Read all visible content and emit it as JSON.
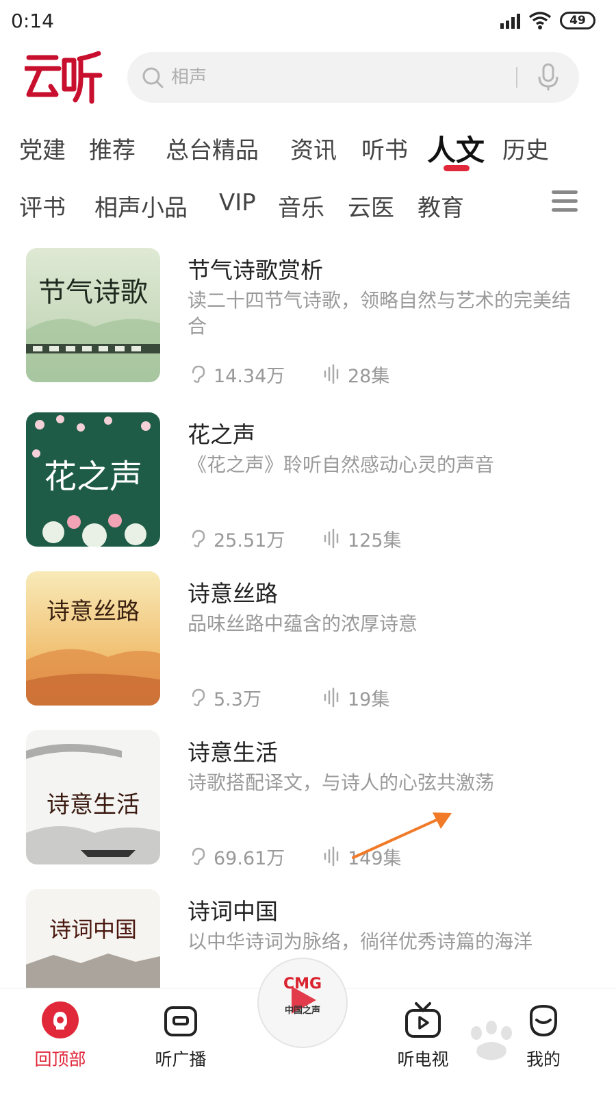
{
  "status_bar": {
    "time": "0:14",
    "battery": "49"
  },
  "app": {
    "logo_text": "云听"
  },
  "search": {
    "placeholder": "相声"
  },
  "tabs_row1": [
    "党建",
    "推荐",
    "总台精品",
    "资讯",
    "听书",
    "人文",
    "历史"
  ],
  "tabs_row2": [
    "评书",
    "相声小品",
    "VIP",
    "音乐",
    "云医",
    "教育"
  ],
  "active_tab": "人文",
  "programs": [
    {
      "title": "节气诗歌赏析",
      "description": "读二十四节气诗歌，领略自然与艺术的完美结合",
      "plays": "14.34万",
      "episodes": "28集",
      "cover_text": "节气诗歌"
    },
    {
      "title": "花之声",
      "description": "《花之声》聆听自然感动心灵的声音",
      "plays": "25.51万",
      "episodes": "125集",
      "cover_text": "花之声"
    },
    {
      "title": "诗意丝路",
      "description": "品味丝路中蕴含的浓厚诗意",
      "plays": "5.3万",
      "episodes": "19集",
      "cover_text": "诗意丝路"
    },
    {
      "title": "诗意生活",
      "description": "诗歌搭配译文，与诗人的心弦共激荡",
      "plays": "69.61万",
      "episodes": "149集",
      "cover_text": "诗意生活"
    },
    {
      "title": "诗词中国",
      "description": "以中华诗词为脉络，徜徉优秀诗篇的海洋",
      "plays": "",
      "episodes": "",
      "cover_text": "诗词中国"
    }
  ],
  "bottom_nav": {
    "back_to_top": "回顶部",
    "radio": "听广播",
    "tv": "听电视",
    "mine": "我的"
  },
  "player": {
    "logo": "CMG",
    "channel": "中国之声"
  },
  "colors": {
    "accent": "#e0283a",
    "muted_text": "#9a9a9a",
    "arrow": "#f07a28"
  }
}
